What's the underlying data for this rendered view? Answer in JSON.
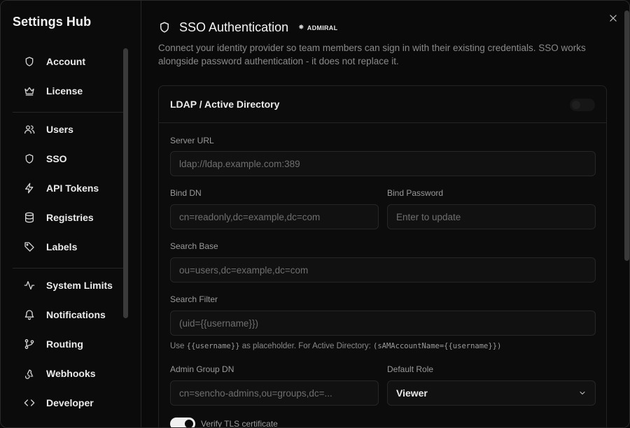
{
  "app": {
    "title": "Settings Hub"
  },
  "sidebar": {
    "group1": [
      {
        "label": "Account",
        "icon": "shield-icon"
      },
      {
        "label": "License",
        "icon": "crown-icon"
      }
    ],
    "group2": [
      {
        "label": "Users",
        "icon": "users-icon"
      },
      {
        "label": "SSO",
        "icon": "shield-icon"
      },
      {
        "label": "API Tokens",
        "icon": "bolt-icon"
      },
      {
        "label": "Registries",
        "icon": "database-icon"
      },
      {
        "label": "Labels",
        "icon": "tag-icon"
      }
    ],
    "group3": [
      {
        "label": "System Limits",
        "icon": "activity-icon"
      },
      {
        "label": "Notifications",
        "icon": "bell-icon"
      },
      {
        "label": "Routing",
        "icon": "git-branch-icon"
      },
      {
        "label": "Webhooks",
        "icon": "webhook-icon"
      },
      {
        "label": "Developer",
        "icon": "code-icon"
      }
    ]
  },
  "header": {
    "title": "SSO Authentication",
    "badge": "ADMIRAL",
    "description": "Connect your identity provider so team members can sign in with their existing credentials. SSO works alongside password authentication - it does not replace it."
  },
  "ldap": {
    "title": "LDAP / Active Directory",
    "enabled": false,
    "server_url": {
      "label": "Server URL",
      "placeholder": "ldap://ldap.example.com:389"
    },
    "bind_dn": {
      "label": "Bind DN",
      "placeholder": "cn=readonly,dc=example,dc=com"
    },
    "bind_password": {
      "label": "Bind Password",
      "placeholder": "Enter to update"
    },
    "search_base": {
      "label": "Search Base",
      "placeholder": "ou=users,dc=example,dc=com"
    },
    "search_filter": {
      "label": "Search Filter",
      "placeholder": "(uid={{username}})"
    },
    "hint": {
      "prefix": "Use",
      "token": "{{username}}",
      "middle": "as placeholder. For Active Directory:",
      "example": "(sAMAccountName={{username}})"
    },
    "admin_group_dn": {
      "label": "Admin Group DN",
      "placeholder": "cn=sencho-admins,ou=groups,dc=..."
    },
    "default_role": {
      "label": "Default Role",
      "value": "Viewer"
    },
    "verify_tls": {
      "label": "Verify TLS certificate",
      "enabled": true
    }
  },
  "colors": {
    "background": "#0a0a0a",
    "border": "#262626",
    "text": "#ededed",
    "muted": "#8a8a8a"
  }
}
